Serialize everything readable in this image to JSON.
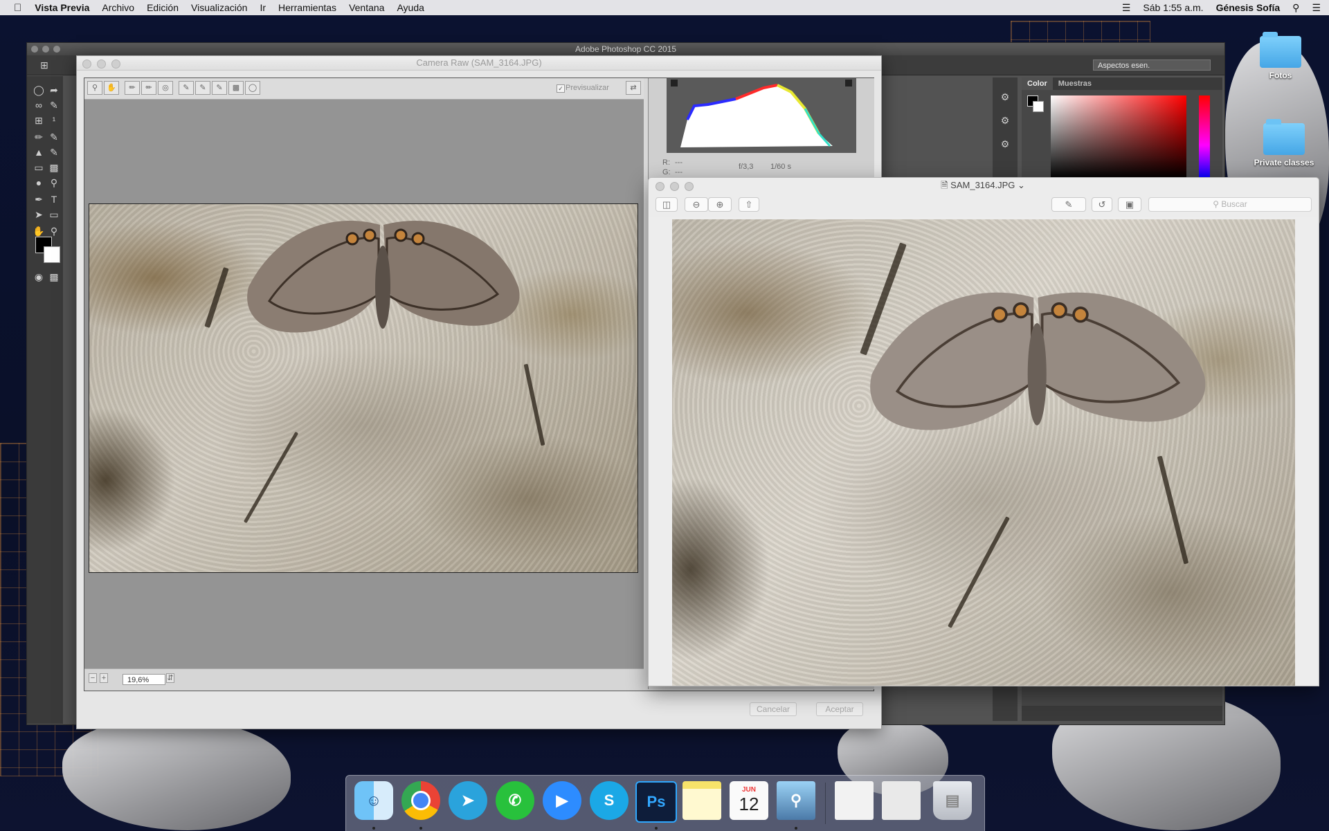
{
  "menubar": {
    "app_name": "Vista Previa",
    "items": [
      "Archivo",
      "Edición",
      "Visualización",
      "Ir",
      "Herramientas",
      "Ventana",
      "Ayuda"
    ],
    "clock": "Sáb 1:55 a.m.",
    "user": "Génesis Sofía"
  },
  "photoshop": {
    "title": "Adobe Photoshop CC 2015",
    "workspace": "Aspectos esen.",
    "panel_tabs": [
      "Color",
      "Muestras"
    ]
  },
  "camera_raw": {
    "title": "Camera Raw (SAM_3164.JPG)",
    "preview_label": "Previsualizar",
    "zoom": "19,6%",
    "rgb_labels": [
      "R:",
      "G:"
    ],
    "rgb_values": [
      "---",
      "---"
    ],
    "aperture": "f/3,3",
    "shutter": "1/60 s",
    "cancel": "Cancelar",
    "accept": "Aceptar"
  },
  "preview": {
    "title": "SAM_3164.JPG",
    "search_placeholder": "Buscar"
  },
  "desktop_icons": [
    "Fotos",
    "Private classes"
  ],
  "dock": {
    "apps": [
      "Finder",
      "Chrome",
      "Telegram",
      "WhatsApp",
      "Zoom",
      "Skype",
      "Ps",
      "Notes",
      "Calendar",
      "Preview",
      "Window",
      "Window",
      "Trash"
    ],
    "calendar_month": "JUN",
    "calendar_day": "12"
  },
  "colors": {
    "ps_bg": "#535353",
    "accent_red": "#ff0000"
  }
}
